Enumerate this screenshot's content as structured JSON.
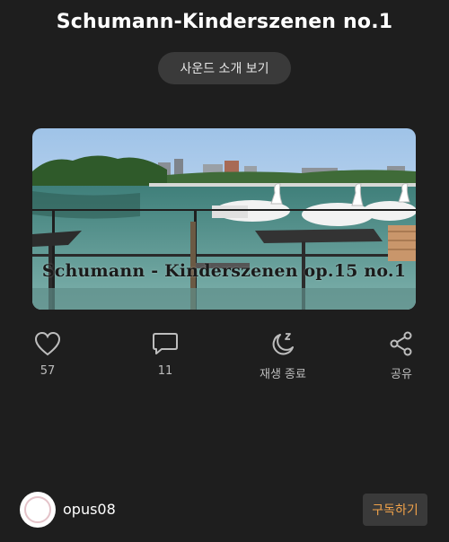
{
  "header": {
    "title": "Schumann-Kinderszenen no.1",
    "intro_button": "사운드 소개 보기"
  },
  "cover": {
    "caption": "Schumann - Kinderszenen op.15 no.1"
  },
  "actions": {
    "like": {
      "icon": "heart-icon",
      "label": "57"
    },
    "comment": {
      "icon": "speech-bubble-icon",
      "label": "11"
    },
    "sleep_timer": {
      "icon": "moon-zzz-icon",
      "label": "재생 종료"
    },
    "share": {
      "icon": "share-icon",
      "label": "공유"
    }
  },
  "footer": {
    "username": "opus08",
    "subscribe_label": "구독하기"
  },
  "colors": {
    "background": "#1e1e1e",
    "pill": "#3a3a3a",
    "accent": "#f0a24a",
    "muted_text": "#bdbdbd"
  }
}
